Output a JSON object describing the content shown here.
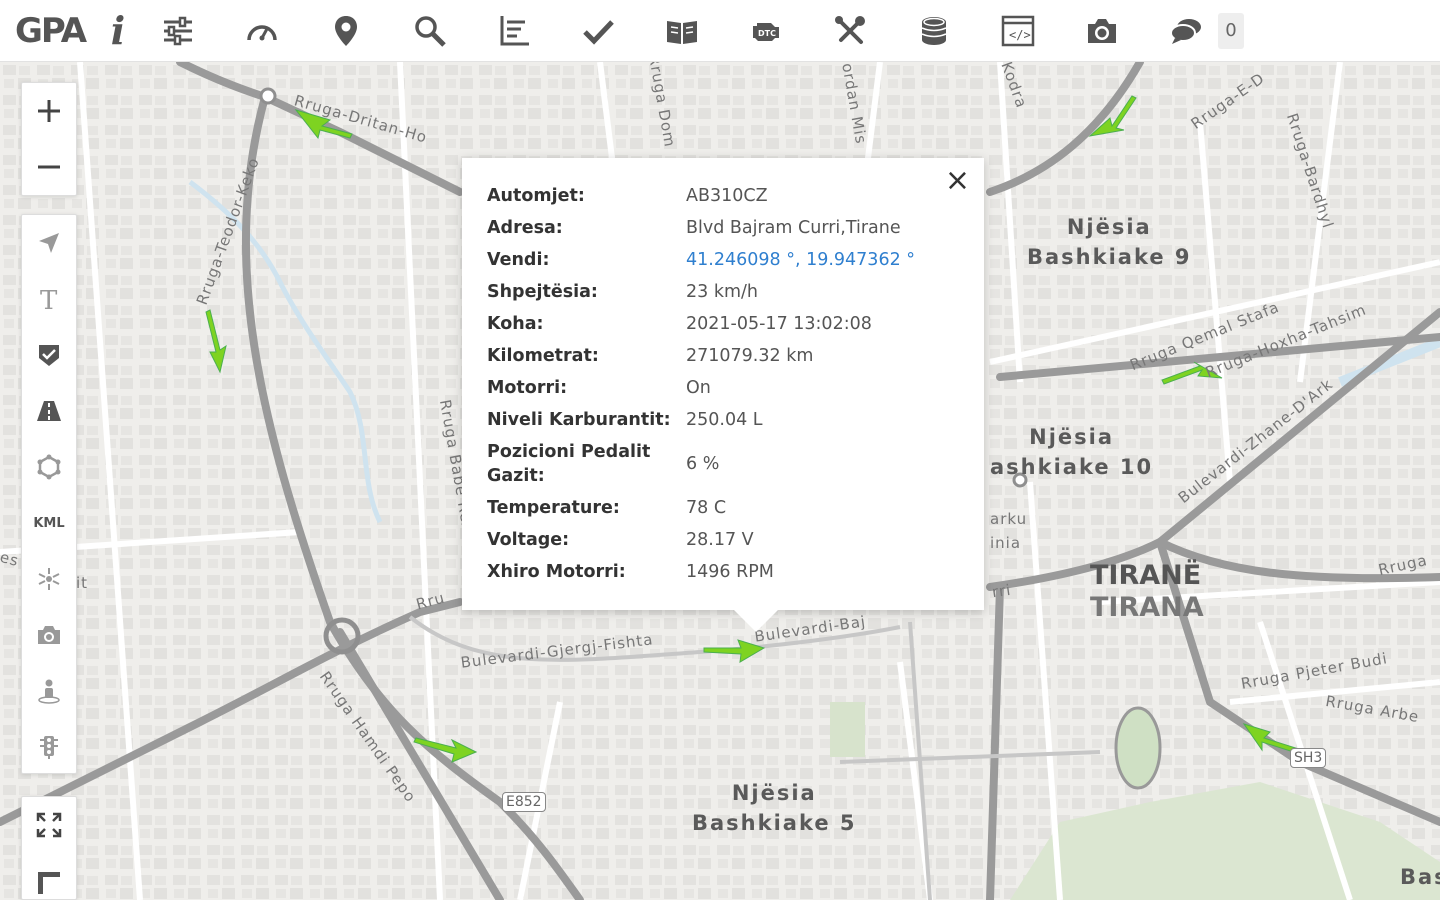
{
  "app": {
    "logo": "GPA",
    "info_label": "i",
    "notification_count": "0"
  },
  "toolbar": [
    {
      "name": "settings-sliders-icon"
    },
    {
      "name": "speedometer-icon"
    },
    {
      "name": "location-pin-icon"
    },
    {
      "name": "search-icon"
    },
    {
      "name": "chart-sort-icon"
    },
    {
      "name": "checkmark-icon"
    },
    {
      "name": "book-icon"
    },
    {
      "name": "engine-dtc-icon"
    },
    {
      "name": "tools-icon"
    },
    {
      "name": "coins-icon"
    },
    {
      "name": "code-window-icon"
    },
    {
      "name": "camera-icon"
    },
    {
      "name": "chat-icon"
    }
  ],
  "map_controls": {
    "kml_label": "KML"
  },
  "map_labels": {
    "district_9": [
      "Njësia",
      "Bashkiake 9"
    ],
    "district_10": [
      "Njësia",
      "ashkiake 10"
    ],
    "district_5": [
      "Njësia",
      "Bashkiake 5"
    ],
    "city_1": "TIRANË",
    "city_2": "TIRANA",
    "streets": {
      "dritan": "Rruga-Dritan-Ho",
      "teodor": "Rruga-Teodor-Keko",
      "babe": "Rruga Babe Rexh",
      "gjergj": "Bulevardi-Gjergj-Fishta",
      "bajram": "Bulevardi-Baj",
      "hamdi": "Rruga Hamdi Pepo",
      "hoxha": "Rruga-Hoxha-Tahsim",
      "qemal": "Rruga Qemal Stafa",
      "zhane": "Bulevardi-Zhane-D'Ark",
      "bardhyl": "Rruga-Bardhyl",
      "pjeter": "Rruga Pjeter Budi",
      "arbe": "Rruga Arbe",
      "rruga_right": "Rruga",
      "kodra": "Kodra",
      "dom": "Rruga Dom",
      "jordan": "Jordan Mis",
      "rrue": "Rruga-E-D",
      "rru_left": "Rru",
      "rri": "rri",
      "parku": "arku",
      "linia": "inia",
      "bas": "Bas",
      "es": "es",
      "it": "it"
    },
    "shield_e852": "E852",
    "shield_sh3": "SH3"
  },
  "popup": {
    "close_label": "×",
    "rows": [
      {
        "key": "Automjet:",
        "value": "AB310CZ"
      },
      {
        "key": "Adresa:",
        "value": "Blvd Bajram Curri,Tirane"
      },
      {
        "key": "Vendi:",
        "value": "41.246098 °, 19.947362 °",
        "link": true
      },
      {
        "key": "Shpejtësia:",
        "value": "23 km/h"
      },
      {
        "key": "Koha:",
        "value": "2021-05-17 13:02:08"
      },
      {
        "key": "Kilometrat:",
        "value": "271079.32 km"
      },
      {
        "key": "Motorri:",
        "value": "On"
      },
      {
        "key": "Niveli Karburantit:",
        "value": "250.04 L"
      },
      {
        "key": "Pozicioni Pedalit Gazit:",
        "value": "6 %"
      },
      {
        "key": "Temperature:",
        "value": "78 C"
      },
      {
        "key": "Voltage:",
        "value": "28.17 V"
      },
      {
        "key": "Xhiro Motorri:",
        "value": "1496 RPM"
      }
    ]
  },
  "colors": {
    "arrow": "#7ed321",
    "link": "#2f7fcf",
    "road_major": "#8e8e8e"
  }
}
